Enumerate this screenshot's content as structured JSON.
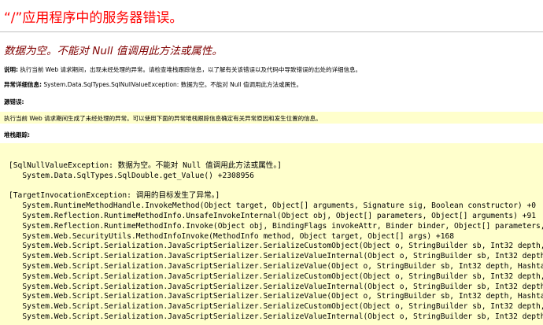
{
  "title": "“/”应用程序中的服务器错误。",
  "error_message": "数据为空。不能对 Null 值调用此方法或属性。",
  "description": {
    "label": "说明:",
    "text": " 执行当前 Web 请求期间，出现未经处理的异常。请检查堆栈跟踪信息，以了解有关该错误以及代码中导致错误的出处的详细信息。"
  },
  "exception_details": {
    "label": "异常详细信息:",
    "text": " System.Data.SqlTypes.SqlNullValueException: 数据为空。不能对 Null 值调用此方法或属性。"
  },
  "source_error": {
    "label": "源错误:",
    "text": "执行当前 Web 请求期间生成了未经处理的异常。可以使用下面的异常堆栈跟踪信息确定有关异常原因和发生位置的信息。"
  },
  "stack_trace": {
    "label": "堆栈跟踪:",
    "blocks": [
      {
        "header": "[SqlNullValueException: 数据为空。不能对 Null 值调用此方法或属性。]",
        "frames": [
          "   System.Data.SqlTypes.SqlDouble.get_Value() +2308956"
        ]
      },
      {
        "header": "[TargetInvocationException: 调用的目标发生了异常。]",
        "frames": [
          "   System.RuntimeMethodHandle.InvokeMethod(Object target, Object[] arguments, Signature sig, Boolean constructor) +0",
          "   System.Reflection.RuntimeMethodInfo.UnsafeInvokeInternal(Object obj, Object[] parameters, Object[] arguments) +91",
          "   System.Reflection.RuntimeMethodInfo.Invoke(Object obj, BindingFlags invokeAttr, Binder binder, Object[] parameters,",
          "   System.Web.SecurityUtils.MethodInfoInvoke(MethodInfo method, Object target, Object[] args) +168",
          "   System.Web.Script.Serialization.JavaScriptSerializer.SerializeCustomObject(Object o, StringBuilder sb, Int32 depth,",
          "   System.Web.Script.Serialization.JavaScriptSerializer.SerializeValueInternal(Object o, StringBuilder sb, Int32 depth,",
          "   System.Web.Script.Serialization.JavaScriptSerializer.SerializeValue(Object o, StringBuilder sb, Int32 depth, Hashtab",
          "   System.Web.Script.Serialization.JavaScriptSerializer.SerializeCustomObject(Object o, StringBuilder sb, Int32 depth,",
          "   System.Web.Script.Serialization.JavaScriptSerializer.SerializeValueInternal(Object o, StringBuilder sb, Int32 depth,",
          "   System.Web.Script.Serialization.JavaScriptSerializer.SerializeValue(Object o, StringBuilder sb, Int32 depth, Hashtab",
          "   System.Web.Script.Serialization.JavaScriptSerializer.SerializeCustomObject(Object o, StringBuilder sb, Int32 depth,",
          "   System.Web.Script.Serialization.JavaScriptSerializer.SerializeValueInternal(Object o, StringBuilder sb, Int32 depth,"
        ]
      }
    ]
  }
}
